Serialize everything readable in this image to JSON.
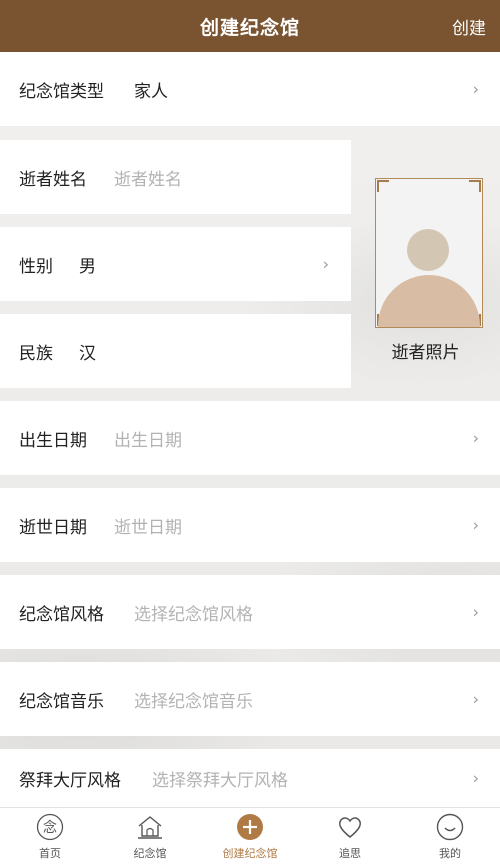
{
  "header": {
    "title": "创建纪念馆",
    "action": "创建"
  },
  "form": {
    "memorial_type": {
      "label": "纪念馆类型",
      "value": "家人"
    },
    "name": {
      "label": "逝者姓名",
      "placeholder": "逝者姓名"
    },
    "gender": {
      "label": "性别",
      "value": "男"
    },
    "ethnicity": {
      "label": "民族",
      "value": "汉"
    },
    "birth_date": {
      "label": "出生日期",
      "placeholder": "出生日期"
    },
    "death_date": {
      "label": "逝世日期",
      "placeholder": "逝世日期"
    },
    "style": {
      "label": "纪念馆风格",
      "placeholder": "选择纪念馆风格"
    },
    "music": {
      "label": "纪念馆音乐",
      "placeholder": "选择纪念馆音乐"
    },
    "hall_style": {
      "label": "祭拜大厅风格",
      "placeholder": "选择祭拜大厅风格"
    }
  },
  "photo": {
    "label": "逝者照片"
  },
  "tabbar": {
    "items": [
      {
        "label": "首页",
        "icon": "nian-logo-icon"
      },
      {
        "label": "纪念馆",
        "icon": "hall-icon"
      },
      {
        "label": "创建纪念馆",
        "icon": "plus-circle-icon",
        "active": true
      },
      {
        "label": "追思",
        "icon": "heart-icon"
      },
      {
        "label": "我的",
        "icon": "smile-icon"
      }
    ]
  },
  "colors": {
    "brand": "#7a5331",
    "accent": "#b07a45"
  }
}
